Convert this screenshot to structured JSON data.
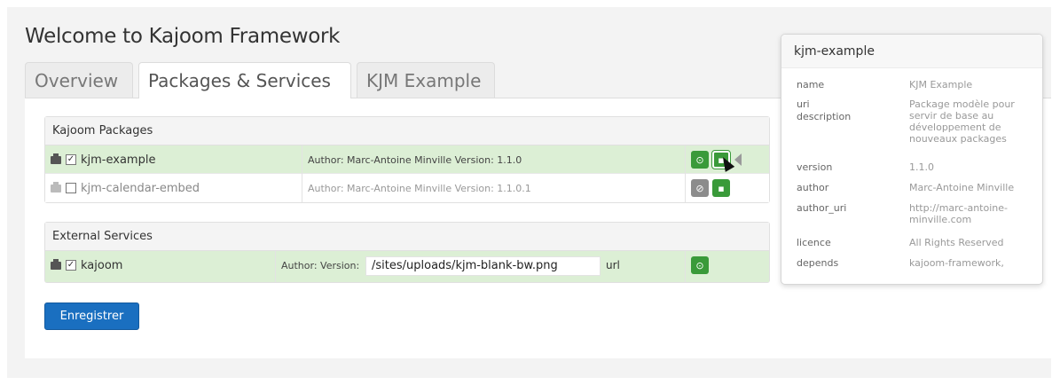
{
  "page": {
    "title": "Welcome to Kajoom Framework"
  },
  "tabs": [
    {
      "label": "Overview",
      "active": false
    },
    {
      "label": "Packages & Services",
      "active": true
    },
    {
      "label": "KJM Example",
      "active": false
    }
  ],
  "packages": {
    "heading": "Kajoom Packages",
    "rows": [
      {
        "name": "kjm-example",
        "checked": true,
        "enabled": true,
        "author": "Author: Marc-Antoine Minville Version: 1.1.0"
      },
      {
        "name": "kjm-calendar-embed",
        "checked": false,
        "enabled": false,
        "author": "Author: Marc-Antoine Minville Version: 1.1.0.1"
      }
    ]
  },
  "services": {
    "heading": "External Services",
    "rows": [
      {
        "name": "kajoom",
        "checked": true,
        "author": "Author: Version:",
        "path_value": "/sites/uploads/kjm-blank-bw.png",
        "url_label": "url"
      }
    ]
  },
  "save_button": {
    "label": "Enregistrer"
  },
  "popover": {
    "title": "kjm-example",
    "rows": [
      {
        "key": "name",
        "value": "KJM Example"
      },
      {
        "key": "uri",
        "value": ""
      },
      {
        "key": "description",
        "value": "Package modèle pour servir de base au développement de nouveaux packages"
      },
      {
        "key": "version",
        "value": "1.1.0"
      },
      {
        "key": "author",
        "value": "Marc-Antoine Minville"
      },
      {
        "key": "author_uri",
        "value": "http://marc-antoine-minville.com"
      },
      {
        "key": "licence",
        "value": "All Rights Reserved"
      },
      {
        "key": "depends",
        "value": "kajoom-framework,"
      }
    ]
  },
  "icons": {
    "package": "briefcase-icon",
    "check": "check-circle-icon",
    "disabled": "ban-icon",
    "info": "info-icon",
    "caret": "caret-left-icon"
  },
  "colors": {
    "row_active": "#dcefd5",
    "button_green": "#3a9a3a",
    "button_gray": "#8c8c8c",
    "save_blue": "#1a6fc0"
  }
}
